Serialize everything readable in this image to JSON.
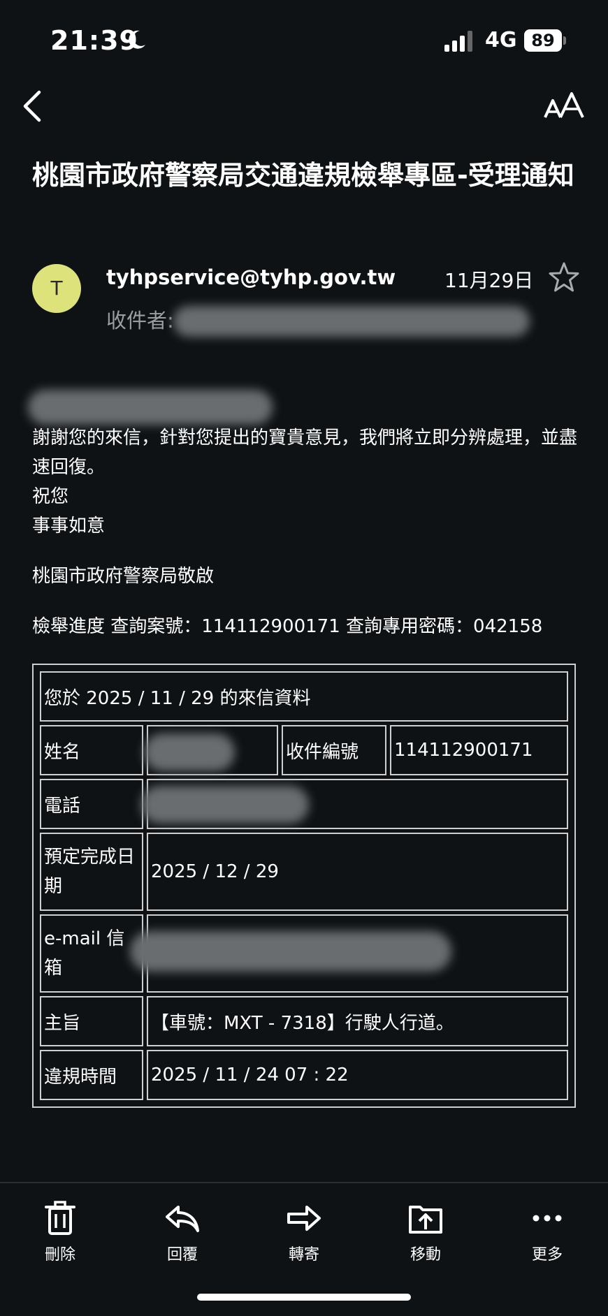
{
  "status_bar": {
    "time": "21:39",
    "network": "4G",
    "battery": "89"
  },
  "email": {
    "subject": "桃園市政府警察局交通違規檢舉專區-受理通知",
    "sender": "tyhpservice@tyhp.gov.tw",
    "date": "11月29日",
    "recipient_label": "收件者:",
    "avatar_letter": "T"
  },
  "body": {
    "line1": "謝謝您的來信，針對您提出的寶貴意見，我們將立即分辨處理，並盡速回復。",
    "line2": "祝您",
    "line3": "事事如意",
    "signature": "桃園市政府警察局敬啟",
    "progress": "檢舉進度 查詢案號：114112900171 查詢專用密碼：042158"
  },
  "table": {
    "header": "您於 2025 / 11 / 29 的來信資料",
    "name_label": "姓名",
    "case_no_label": "收件編號",
    "case_no_value": "114112900171",
    "phone_label": "電話",
    "due_label": "預定完成日期",
    "due_value": "2025 / 12 / 29",
    "email_label": "e-mail 信箱",
    "subject_label": "主旨",
    "subject_value": "【車號：MXT - 7318】行駛人行道。",
    "violation_time_label": "違規時間",
    "violation_time_value": "2025 / 11 / 24 07 : 22"
  },
  "toolbar": {
    "delete": "刪除",
    "reply": "回覆",
    "forward": "轉寄",
    "move": "移動",
    "more": "更多"
  }
}
